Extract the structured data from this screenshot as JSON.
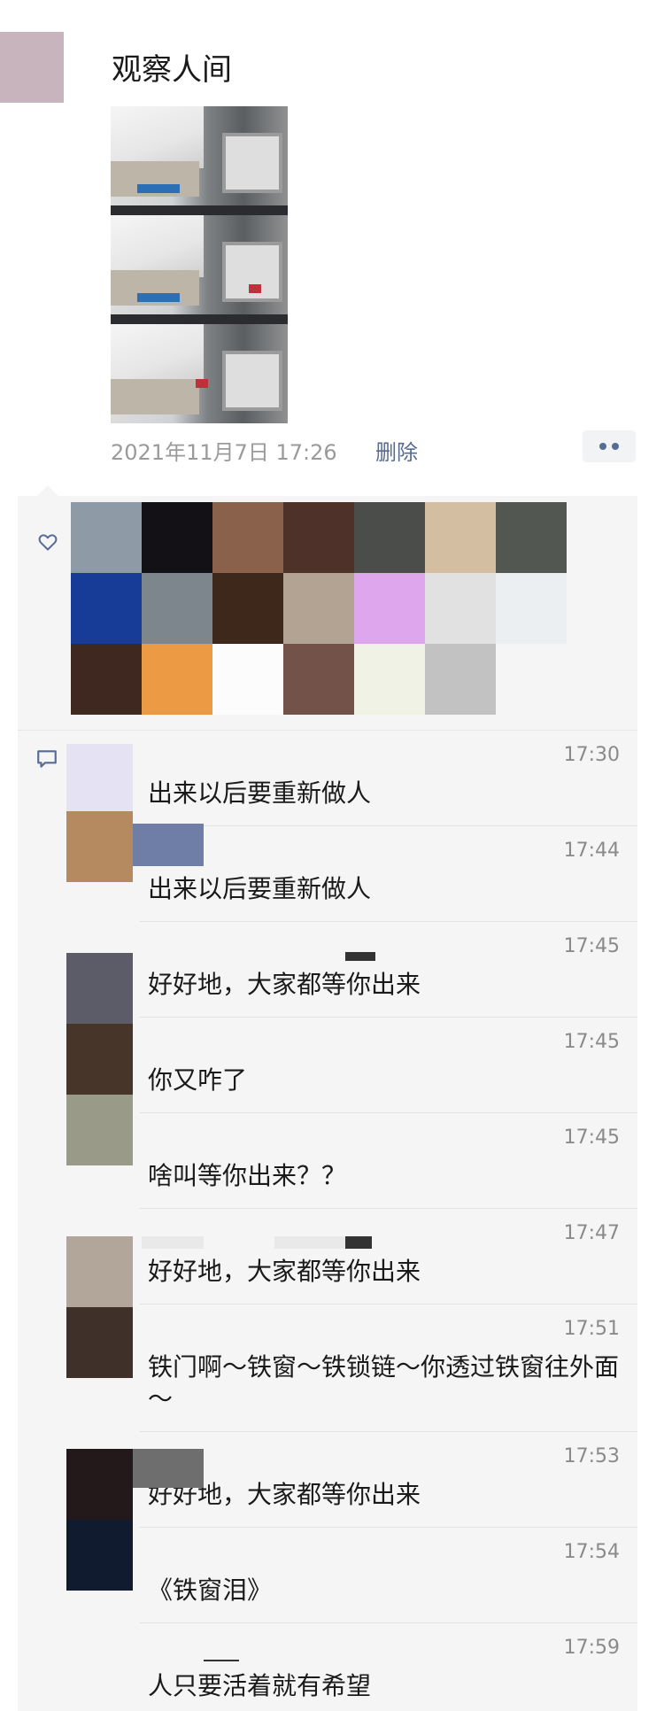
{
  "post": {
    "author": "观察人间",
    "date": "2021年11月7日 17:26",
    "delete_label": "删除"
  },
  "icons": {
    "more": "more-dots-icon",
    "like": "heart-icon",
    "comment": "comment-icon"
  },
  "likes": {
    "avatar_colors": [
      "#8e9aa6",
      "#131116",
      "#8a614a",
      "#4e3128",
      "#4b4d4a",
      "#d3bea2",
      "#525851",
      "#173c97",
      "#7d868c",
      "#3e281b",
      "#b3a393",
      "#dea6ec",
      "#e1e1e1",
      "#eceff2",
      "#3f2820",
      "#ec9a44",
      "#fcfcfc",
      "#725249",
      "#f1f2e6",
      "#c2c2c2"
    ]
  },
  "comments": [
    {
      "time": "17:30",
      "text": "出来以后要重新做人",
      "avatar_color": "#e5e2f4"
    },
    {
      "time": "17:44",
      "text": "出来以后要重新做人",
      "avatar_color": "#b58a60"
    },
    {
      "time": "17:45",
      "text": "好好地，大家都等你出来",
      "avatar_color": "#5b5c67"
    },
    {
      "time": "17:45",
      "text": "你又咋了",
      "avatar_color": "#473529"
    },
    {
      "time": "17:45",
      "text": "啥叫等你出来？？",
      "avatar_color": "#999b88"
    },
    {
      "time": "17:47",
      "text": "好好地，大家都等你出来",
      "avatar_color": "#b2a59a"
    },
    {
      "time": "17:51",
      "text": "铁门啊～铁窗～铁锁链～你透过铁窗往外面～",
      "avatar_color": "#3f3029"
    },
    {
      "time": "17:53",
      "text": "好好地，大家都等你出来",
      "avatar_color": "#23191a"
    },
    {
      "time": "17:54",
      "text": "《铁窗泪》",
      "avatar_color": "#101b30"
    },
    {
      "time": "17:59",
      "text": "人只要活着就有希望",
      "avatar_color": "#f5f5f5"
    }
  ]
}
